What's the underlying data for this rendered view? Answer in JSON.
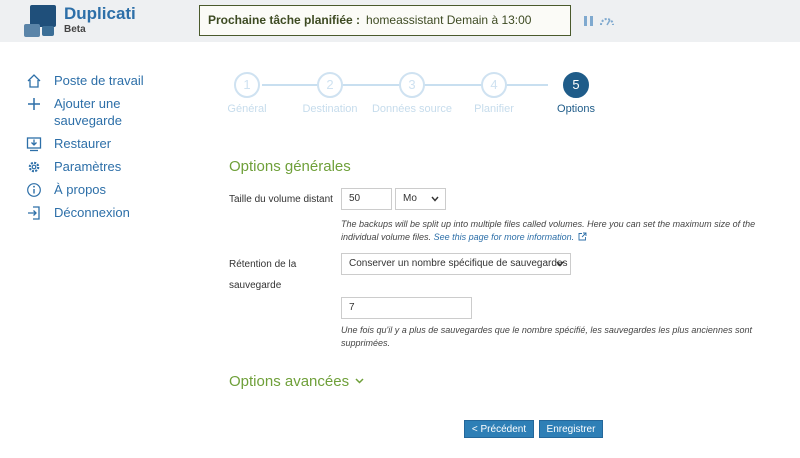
{
  "app": {
    "name": "Duplicati",
    "badge": "Beta"
  },
  "header": {
    "next_task_label": "Prochaine tâche planifiée :",
    "next_task_value": "homeassistant Demain à 13:00"
  },
  "sidebar": {
    "items": [
      {
        "label": "Poste de travail",
        "icon": "home-icon"
      },
      {
        "label": "Ajouter une sauvegarde",
        "icon": "plus-icon"
      },
      {
        "label": "Restaurer",
        "icon": "restore-icon"
      },
      {
        "label": "Paramètres",
        "icon": "gear-icon"
      },
      {
        "label": "À propos",
        "icon": "info-icon"
      },
      {
        "label": "Déconnexion",
        "icon": "logout-icon"
      }
    ]
  },
  "wizard": {
    "steps": [
      {
        "num": "1",
        "label": "Général"
      },
      {
        "num": "2",
        "label": "Destination"
      },
      {
        "num": "3",
        "label": "Données source"
      },
      {
        "num": "4",
        "label": "Planifier"
      },
      {
        "num": "5",
        "label": "Options"
      }
    ],
    "active_step": 5
  },
  "options": {
    "title": "Options générales",
    "volume_size": {
      "label": "Taille du volume distant",
      "value": "50",
      "unit": "Mo",
      "help": "The backups will be split up into multiple files called volumes. Here you can set the maximum size of the individual volume files.",
      "help_link": "See this page for more information."
    },
    "retention": {
      "label_line1": "Rétention de la",
      "label_line2": "sauvegarde",
      "selected": "Conserver un nombre spécifique de sauvegardes",
      "count": "7",
      "help": "Une fois qu'il y a plus de sauvegardes que le nombre spécifié, les sauvegardes les plus anciennes sont supprimées."
    },
    "advanced_label": "Options avancées"
  },
  "buttons": {
    "previous": "< Précédent",
    "save": "Enregistrer"
  },
  "colors": {
    "accent_blue": "#2d6fa8",
    "section_green": "#6fa03a",
    "active_step": "#1f5c89"
  }
}
